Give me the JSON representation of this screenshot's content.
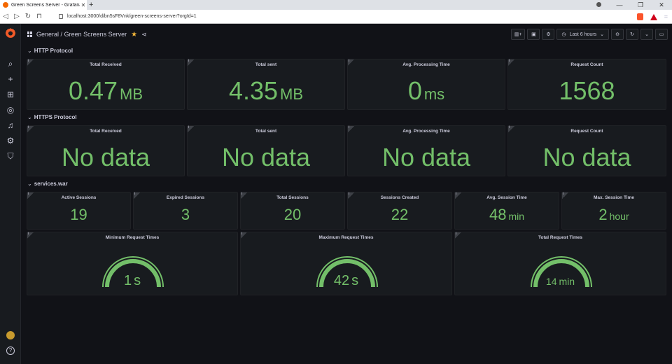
{
  "browser": {
    "tab_title": "Green Screens Server - Grafana",
    "url": "localhost:3000/d/bn5sF8Vnk/green-screens-server?orgId=1"
  },
  "nav": {
    "folder": "General",
    "separator": "/",
    "dashboard": "Green Screens Server",
    "time_range": "Last 6 hours"
  },
  "rows": {
    "http": "HTTP Protocol",
    "https": "HTTPS Protocol",
    "services": "services.war"
  },
  "http_panels": [
    {
      "title": "Total Received",
      "value": "0.47",
      "unit": "MB"
    },
    {
      "title": "Total sent",
      "value": "4.35",
      "unit": "MB"
    },
    {
      "title": "Avg. Processing Time",
      "value": "0",
      "unit": "ms"
    },
    {
      "title": "Request Count",
      "value": "1568",
      "unit": ""
    }
  ],
  "https_panels": [
    {
      "title": "Total Received",
      "value": "No data"
    },
    {
      "title": "Total sent",
      "value": "No data"
    },
    {
      "title": "Avg. Processing Time",
      "value": "No data"
    },
    {
      "title": "Request Count",
      "value": "No data"
    }
  ],
  "service_panels": [
    {
      "title": "Active Sessions",
      "value": "19",
      "unit": ""
    },
    {
      "title": "Expired Sessions",
      "value": "3",
      "unit": ""
    },
    {
      "title": "Total Sessions",
      "value": "20",
      "unit": ""
    },
    {
      "title": "Sessions Created",
      "value": "22",
      "unit": ""
    },
    {
      "title": "Avg. Session Time",
      "value": "48",
      "unit": "min"
    },
    {
      "title": "Max. Session Time",
      "value": "2",
      "unit": "hour"
    }
  ],
  "gauge_panels": [
    {
      "title": "Minimum Request Times",
      "value": "1",
      "unit": "s"
    },
    {
      "title": "Maximum Request Times",
      "value": "42",
      "unit": "s"
    },
    {
      "title": "Total Request Times",
      "value": "14",
      "unit": "min"
    }
  ],
  "colors": {
    "value_green": "#73bf69",
    "panel_bg": "#181b1f",
    "page_bg": "#111217",
    "star": "#f5b73b"
  }
}
